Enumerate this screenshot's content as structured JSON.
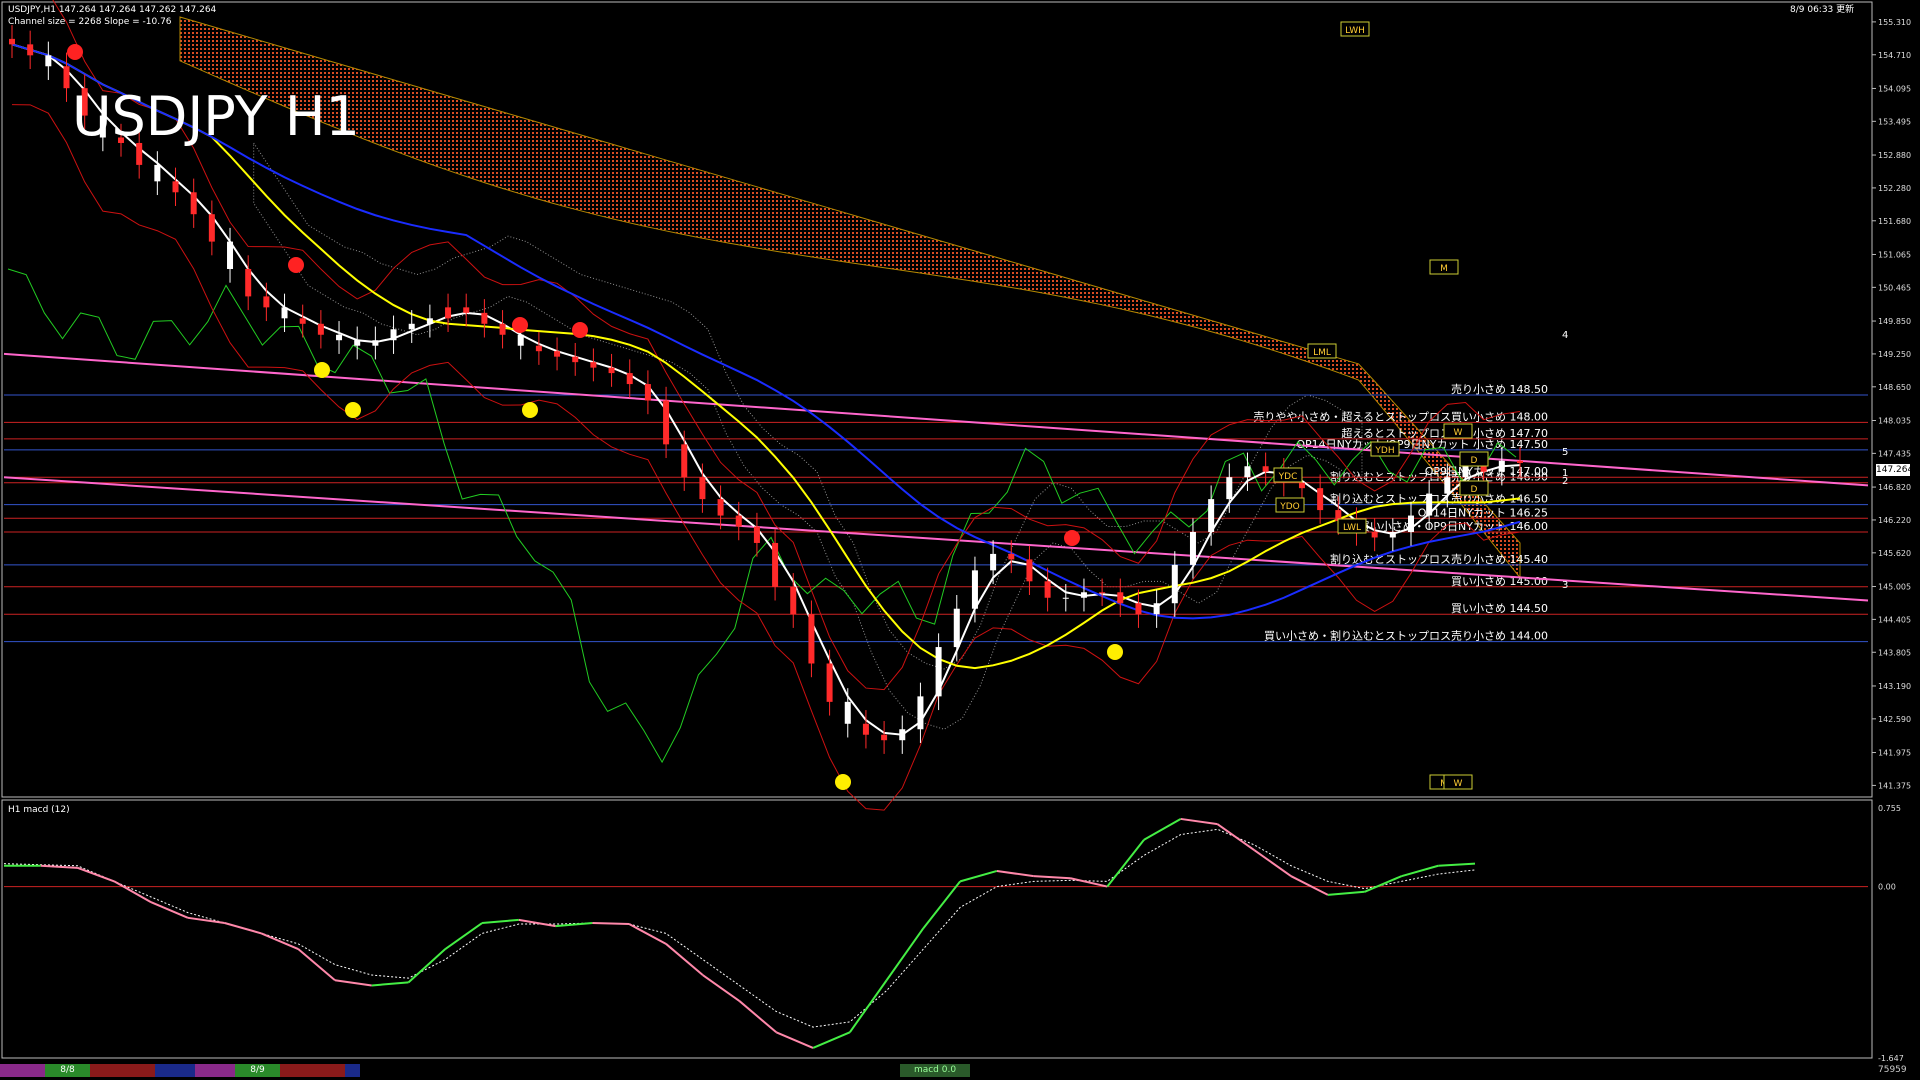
{
  "header": {
    "symbol_line": "USDJPY,H1  147.264 147.264 147.262 147.264",
    "channel_line": "Channel size = 2268 Slope = -10.76",
    "datetime": "8/9 06:33 更新",
    "big_title": "USDJPY H1"
  },
  "colors": {
    "background": "#000000",
    "bull_candle": "#ffffff",
    "bear_candle": "#ff2a2a",
    "kumo": "#ff5a2a",
    "kumo_white": "#d0d0d0",
    "ma_white": "#ffffff",
    "ma_yellow": "#ffff00",
    "ma_blue": "#1a2cff",
    "chikou": "#22cc22",
    "bands": "#cc1111",
    "trend_pink": "#ff66cc",
    "levels_red": "#cc2222",
    "levels_blue": "#3355cc",
    "macd_up": "#44ee44",
    "macd_down": "#ff88aa",
    "arrow": "#ffee00"
  },
  "chart_data": [
    {
      "type": "candlestick",
      "title": "USDJPY H1",
      "yticks": [
        "155.310",
        "154.710",
        "154.095",
        "153.495",
        "152.880",
        "152.280",
        "151.680",
        "151.065",
        "150.465",
        "149.850",
        "149.250",
        "148.650",
        "148.035",
        "147.435",
        "146.820",
        "146.220",
        "145.620",
        "145.005",
        "144.405",
        "143.805",
        "143.190",
        "142.590",
        "141.975",
        "141.375"
      ],
      "current_price": "147.264",
      "ylim": [
        141.2,
        155.6
      ],
      "close_path": [
        154.9,
        154.7,
        154.5,
        154.1,
        153.6,
        153.2,
        153.1,
        152.7,
        152.4,
        152.2,
        151.8,
        151.3,
        150.8,
        150.3,
        150.1,
        149.9,
        149.8,
        149.6,
        149.5,
        149.4,
        149.5,
        149.7,
        149.8,
        149.9,
        150.1,
        150.0,
        149.8,
        149.6,
        149.4,
        149.3,
        149.2,
        149.1,
        149.0,
        148.9,
        148.7,
        148.4,
        147.6,
        147.0,
        146.6,
        146.3,
        146.1,
        145.8,
        145.0,
        144.5,
        143.6,
        142.9,
        142.5,
        142.3,
        142.2,
        142.4,
        143.0,
        143.9,
        144.6,
        145.3,
        145.6,
        145.5,
        145.1,
        144.8,
        144.8,
        144.9,
        144.9,
        144.7,
        144.5,
        144.7,
        145.4,
        146.0,
        146.6,
        147.0,
        147.2,
        147.1,
        146.9,
        146.8,
        146.4,
        146.2,
        146.0,
        145.9,
        146.0,
        146.3,
        146.7,
        147.0,
        147.2,
        147.1,
        147.3,
        147.26
      ],
      "candle_colors_up": [
        0,
        0,
        1,
        0,
        0,
        1,
        0,
        0,
        1,
        0,
        0,
        0,
        1,
        0,
        0,
        1,
        0,
        0,
        1,
        1,
        1,
        1,
        1,
        1,
        0,
        0,
        0,
        0,
        1,
        0,
        0,
        0,
        0,
        0,
        0,
        0,
        0,
        0,
        0,
        0,
        0,
        0,
        0,
        0,
        0,
        0,
        1,
        0,
        0,
        1,
        1,
        1,
        1,
        1,
        1,
        0,
        0,
        0,
        1,
        1,
        0,
        0,
        0,
        1,
        1,
        1,
        1,
        1,
        1,
        0,
        0,
        0,
        0,
        0,
        0,
        0,
        1,
        1,
        1,
        1,
        1,
        0,
        1,
        0
      ],
      "price_tags": [
        {
          "label": "売り小さめ 148.50",
          "price": 148.5
        },
        {
          "label": "売りやや小さめ・超えるとストップロス買い小さめ 148.00",
          "price": 148.0
        },
        {
          "label": "超えるとストップロス買い小さめ 147.70",
          "price": 147.7
        },
        {
          "label": "OP14日NYカット/OP9日NYカット 小さめ 147.50",
          "price": 147.5
        },
        {
          "label": "割り込むとストップロス売り小さめ 146.90",
          "price": 146.9
        },
        {
          "label": "OP9日NYカット 147.00",
          "price": 147.0
        },
        {
          "label": "割り込むとストップロス売り小さめ 146.50",
          "price": 146.5
        },
        {
          "label": "OP14日NYカット 146.25",
          "price": 146.25
        },
        {
          "label": "買い小さめ・OP9日NYカット 146.00",
          "price": 146.0
        },
        {
          "label": "割り込むとストップロス売り小さめ 145.40",
          "price": 145.4
        },
        {
          "label": "買い小さめ 145.00",
          "price": 145.0
        },
        {
          "label": "買い小さめ 144.50",
          "price": 144.5
        },
        {
          "label": "買い小さめ・割り込むとストップロス売り小さめ 144.00",
          "price": 144.0
        }
      ],
      "marker_labels": [
        "LWH",
        "LML",
        "YDH",
        "YDC",
        "YDO",
        "LWL",
        "M",
        "M",
        "W",
        "W",
        "D",
        "D"
      ],
      "channel_numbers": [
        "4",
        "5",
        "1",
        "2",
        "3"
      ]
    },
    {
      "type": "line",
      "title": "H1  macd (12)",
      "yticks": [
        "0.755",
        "0.00",
        "-1.647"
      ],
      "ylim": [
        -1.647,
        0.755
      ],
      "macd": [
        0.2,
        0.2,
        0.18,
        0.05,
        -0.15,
        -0.3,
        -0.35,
        -0.45,
        -0.6,
        -0.9,
        -0.95,
        -0.92,
        -0.6,
        -0.35,
        -0.32,
        -0.38,
        -0.35,
        -0.36,
        -0.55,
        -0.85,
        -1.1,
        -1.4,
        -1.55,
        -1.4,
        -0.9,
        -0.4,
        0.05,
        0.15,
        0.1,
        0.08,
        0.0,
        0.45,
        0.65,
        0.6,
        0.35,
        0.1,
        -0.08,
        -0.05,
        0.1,
        0.2,
        0.22
      ],
      "signal": [
        0.22,
        0.21,
        0.2,
        0.05,
        -0.1,
        -0.25,
        -0.35,
        -0.45,
        -0.55,
        -0.75,
        -0.85,
        -0.88,
        -0.7,
        -0.45,
        -0.36,
        -0.36,
        -0.35,
        -0.36,
        -0.45,
        -0.7,
        -0.95,
        -1.2,
        -1.35,
        -1.3,
        -1.0,
        -0.6,
        -0.2,
        0.0,
        0.05,
        0.06,
        0.05,
        0.3,
        0.5,
        0.55,
        0.4,
        0.2,
        0.05,
        -0.02,
        0.05,
        0.12,
        0.16
      ]
    }
  ],
  "bottom_bar": {
    "date_1": "8/8",
    "date_2": "8/9",
    "macd_tab": "macd 0.0",
    "counter": "75959"
  }
}
